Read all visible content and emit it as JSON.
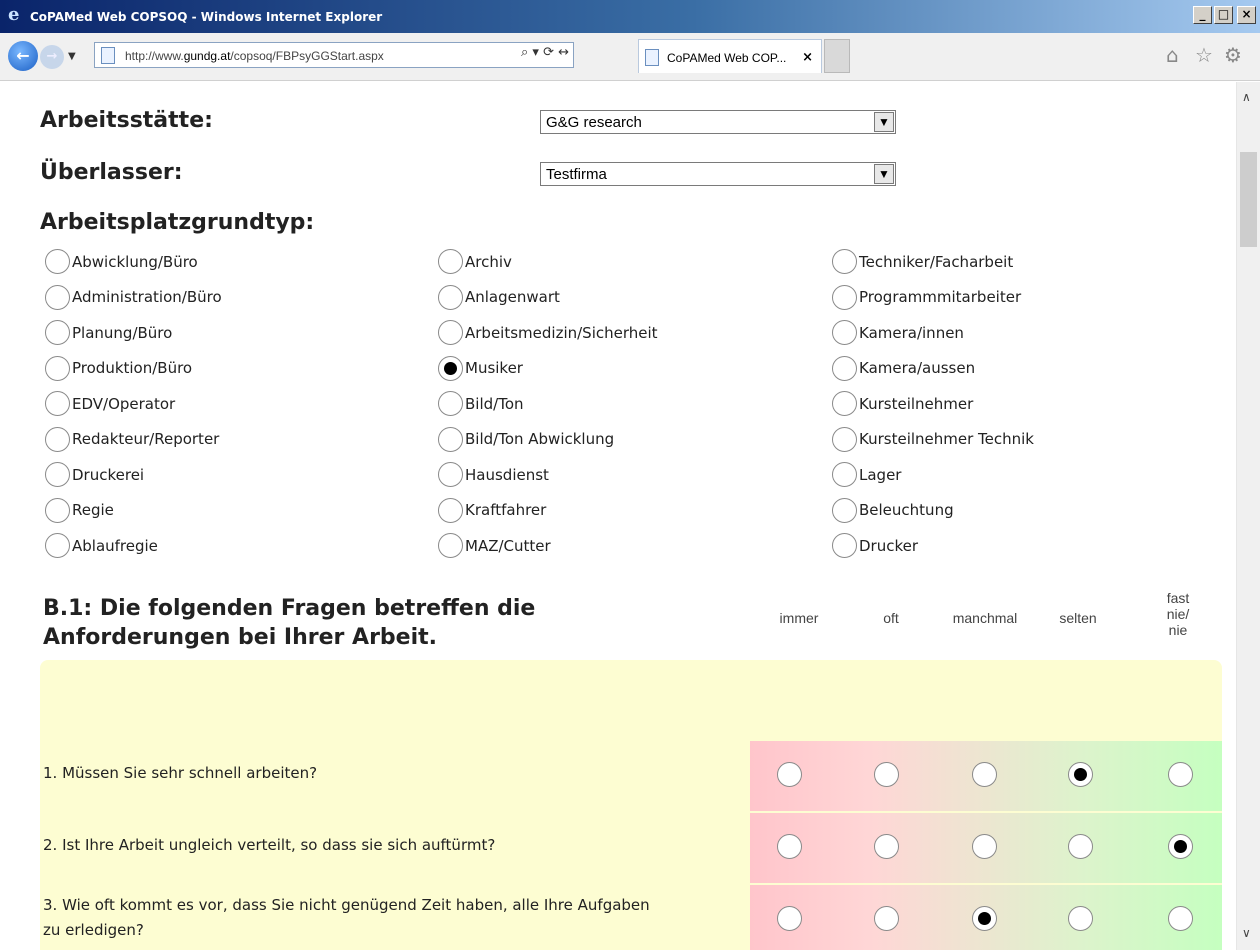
{
  "window": {
    "title": "CoPAMed Web COPSOQ - Windows Internet Explorer",
    "minimize": "_",
    "maximize": "□",
    "close": "×"
  },
  "browser": {
    "url_prefix": "http://www.",
    "url_domain": "gundg.at",
    "url_path": "/copsoq/FBPsyGGStart.aspx",
    "tab_title": "CoPAMed Web COP...",
    "tab_close": "×",
    "tools": "⌕ ▾ ⟳ ↔"
  },
  "form": {
    "workplace_label": "Arbeitsstätte:",
    "workplace_value": "G&G research",
    "lender_label": "Überlasser:",
    "lender_value": "Testfirma",
    "basetype_label": "Arbeitsplatzgrundtyp:",
    "basetypes_col1": [
      "Abwicklung/Büro",
      "Administration/Büro",
      "Planung/Büro",
      "Produktion/Büro",
      "EDV/Operator",
      "Redakteur/Reporter",
      "Druckerei",
      "Regie",
      "Ablaufregie"
    ],
    "basetypes_col2": [
      "Archiv",
      "Anlagenwart",
      "Arbeitsmedizin/Sicherheit",
      "Musiker",
      "Bild/Ton",
      "Bild/Ton Abwicklung",
      "Hausdienst",
      "Kraftfahrer",
      "MAZ/Cutter"
    ],
    "basetypes_col3": [
      "Techniker/Facharbeit",
      "Programmmitarbeiter",
      "Kamera/innen",
      "Kamera/aussen",
      "Kursteilnehmer",
      "Kursteilnehmer Technik",
      "Lager",
      "Beleuchtung",
      "Drucker"
    ],
    "selected_basetype": "Musiker"
  },
  "section": {
    "title_line1": "B.1: Die folgenden Fragen betreffen die",
    "title_line2": "Anforderungen bei Ihrer Arbeit.",
    "columns": [
      "immer",
      "oft",
      "manchmal",
      "selten",
      "fast\nnie/\nnie"
    ],
    "questions": [
      {
        "text": "1. Müssen Sie sehr schnell arbeiten?",
        "answer": "selten"
      },
      {
        "text": "2. Ist Ihre Arbeit ungleich verteilt, so dass sie sich auftürmt?",
        "answer": "fast nie/ nie"
      },
      {
        "text_line1": "3. Wie oft kommt es vor, dass Sie nicht genügend Zeit haben, alle Ihre Aufgaben",
        "text_line2": "zu erledigen?",
        "answer": "manchmal"
      }
    ]
  }
}
